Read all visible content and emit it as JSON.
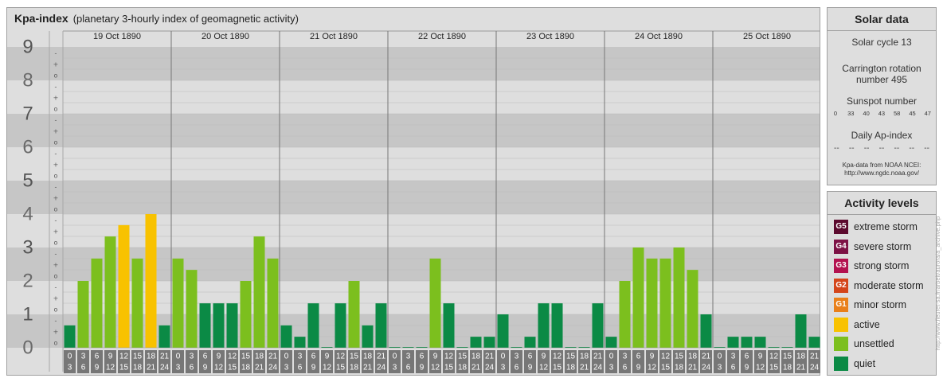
{
  "header": {
    "title": "Kpa-index",
    "subtitle": "(planetary 3-hourly index of geomagnetic activity)"
  },
  "chart_data": {
    "type": "bar",
    "title": "Kpa-index",
    "subtitle": "(planetary 3-hourly index of geomagnetic activity)",
    "ylim": [
      0,
      9
    ],
    "y_ticks": [
      "0",
      "1",
      "2",
      "3",
      "4",
      "5",
      "6",
      "7",
      "8",
      "9"
    ],
    "thirds_labels": [
      "-",
      "o",
      "+"
    ],
    "days": [
      "19 Oct 1890",
      "20 Oct 1890",
      "21 Oct 1890",
      "22 Oct 1890",
      "23 Oct 1890",
      "24 Oct 1890",
      "25 Oct 1890"
    ],
    "interval_labels": [
      [
        "0",
        "3"
      ],
      [
        "3",
        "6"
      ],
      [
        "6",
        "9"
      ],
      [
        "9",
        "12"
      ],
      [
        "12",
        "15"
      ],
      [
        "15",
        "18"
      ],
      [
        "18",
        "21"
      ],
      [
        "21",
        "24"
      ]
    ],
    "values": [
      [
        0.67,
        2.0,
        2.67,
        3.33,
        3.67,
        2.67,
        4.0,
        0.67
      ],
      [
        2.67,
        2.33,
        1.33,
        1.33,
        1.33,
        2.0,
        3.33,
        2.67
      ],
      [
        0.67,
        0.33,
        1.33,
        0.0,
        1.33,
        2.0,
        0.67,
        1.33
      ],
      [
        0.0,
        0.0,
        0.0,
        2.67,
        1.33,
        0.0,
        0.33,
        0.33
      ],
      [
        1.0,
        0.0,
        0.33,
        1.33,
        1.33,
        0.0,
        0.0,
        1.33
      ],
      [
        0.33,
        2.0,
        3.0,
        2.67,
        2.67,
        3.0,
        2.33,
        1.0
      ],
      [
        0.0,
        0.33,
        0.33,
        0.33,
        0.0,
        0.0,
        1.0,
        0.33
      ]
    ],
    "color_thresholds": [
      {
        "min": 0,
        "max": 1.5,
        "level": "quiet"
      },
      {
        "min": 1.5,
        "max": 3.5,
        "level": "unsettled"
      },
      {
        "min": 3.5,
        "max": 4.5,
        "level": "active"
      },
      {
        "min": 4.5,
        "max": 5.5,
        "level": "G1"
      },
      {
        "min": 5.5,
        "max": 6.5,
        "level": "G2"
      },
      {
        "min": 6.5,
        "max": 7.5,
        "level": "G3"
      },
      {
        "min": 7.5,
        "max": 8.5,
        "level": "G4"
      },
      {
        "min": 8.5,
        "max": 9.01,
        "level": "G5"
      }
    ]
  },
  "solar": {
    "title": "Solar data",
    "cycle": "Solar cycle 13",
    "carrington_line1": "Carrington rotation",
    "carrington_line2": "number 495",
    "sunspot_title": "Sunspot number",
    "sunspot_values": [
      "0",
      "33",
      "40",
      "43",
      "58",
      "45",
      "47"
    ],
    "ap_title": "Daily Ap-index",
    "ap_values": [
      "--",
      "--",
      "--",
      "--",
      "--",
      "--",
      "--"
    ],
    "credit_line1": "Kpa-data from NOAA NCEI:",
    "credit_line2": "http://www.ngdc.noaa.gov/"
  },
  "levels": {
    "title": "Activity levels",
    "items": [
      {
        "badge": "G5",
        "label": "extreme storm",
        "color": "#5c0a2e"
      },
      {
        "badge": "G4",
        "label": "severe storm",
        "color": "#7d1245"
      },
      {
        "badge": "G3",
        "label": "strong storm",
        "color": "#b3124f"
      },
      {
        "badge": "G2",
        "label": "moderate storm",
        "color": "#d4451a"
      },
      {
        "badge": "G1",
        "label": "minor storm",
        "color": "#e9801a"
      },
      {
        "badge": "",
        "label": "active",
        "color": "#f8c200"
      },
      {
        "badge": "",
        "label": "unsettled",
        "color": "#7cbf1e"
      },
      {
        "badge": "",
        "label": "quiet",
        "color": "#0b8a45"
      }
    ]
  },
  "watermark": "http://www.fleuret-sa.fr/arbeit/aurora/a_archive.php"
}
